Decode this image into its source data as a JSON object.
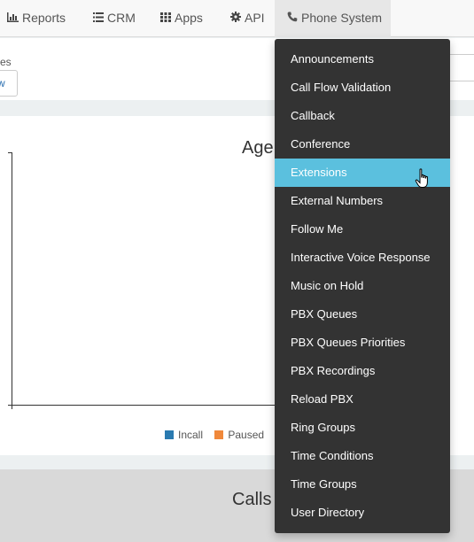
{
  "nav": {
    "items": [
      {
        "label": "Reports",
        "icon": "bar-chart-icon"
      },
      {
        "label": "CRM",
        "icon": "list-icon"
      },
      {
        "label": "Apps",
        "icon": "grid-icon"
      },
      {
        "label": "API",
        "icon": "gear-icon"
      },
      {
        "label": "Phone System",
        "icon": "phone-icon"
      }
    ]
  },
  "toolbar": {
    "partial_text": "es",
    "partial_button": "w"
  },
  "chart": {
    "title_partial": "Age",
    "legend": [
      {
        "label": "Incall",
        "color": "#2a7ab0"
      },
      {
        "label": "Paused",
        "color": "#f0883a"
      },
      {
        "label": "",
        "color": "#2ca02c"
      }
    ]
  },
  "calls_panel": {
    "title_partial": "Calls"
  },
  "dropdown": {
    "items": [
      {
        "label": "Announcements"
      },
      {
        "label": "Call Flow Validation"
      },
      {
        "label": "Callback"
      },
      {
        "label": "Conference"
      },
      {
        "label": "Extensions",
        "hovered": true
      },
      {
        "label": "External Numbers"
      },
      {
        "label": "Follow Me"
      },
      {
        "label": "Interactive Voice Response"
      },
      {
        "label": "Music on Hold"
      },
      {
        "label": "PBX Queues"
      },
      {
        "label": "PBX Queues Priorities"
      },
      {
        "label": "PBX Recordings"
      },
      {
        "label": "Reload PBX"
      },
      {
        "label": "Ring Groups"
      },
      {
        "label": "Time Conditions"
      },
      {
        "label": "Time Groups"
      },
      {
        "label": "User Directory"
      }
    ]
  }
}
